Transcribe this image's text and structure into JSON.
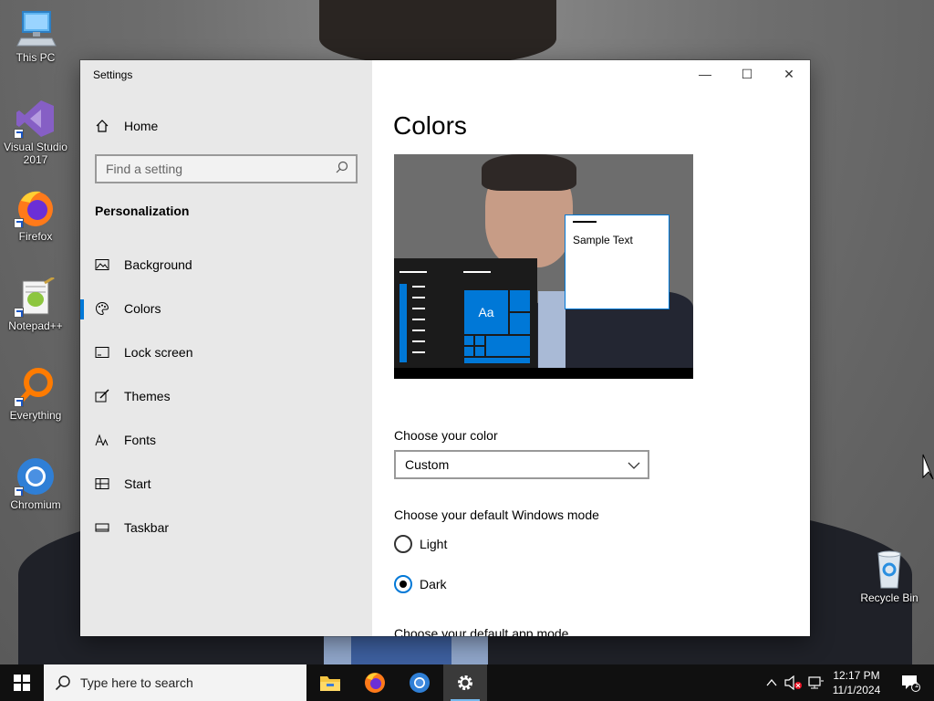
{
  "desktop": {
    "icons": [
      {
        "label": "This PC",
        "icon": "computer-icon"
      },
      {
        "label": "Visual Studio 2017",
        "icon": "visual-studio-icon"
      },
      {
        "label": "Firefox",
        "icon": "firefox-icon"
      },
      {
        "label": "Notepad++",
        "icon": "notepad-plus-plus-icon"
      },
      {
        "label": "Everything",
        "icon": "everything-search-icon"
      },
      {
        "label": "Chromium",
        "icon": "chromium-icon"
      },
      {
        "label": "Recycle Bin",
        "icon": "recycle-bin-icon"
      }
    ]
  },
  "window": {
    "title": "Settings",
    "controls": {
      "minimize": "—",
      "maximize": "☐",
      "close": "✕"
    }
  },
  "sidebar": {
    "home_label": "Home",
    "search_placeholder": "Find a setting",
    "section_title": "Personalization",
    "items": [
      {
        "label": "Background",
        "icon": "image-icon"
      },
      {
        "label": "Colors",
        "icon": "palette-icon",
        "active": true
      },
      {
        "label": "Lock screen",
        "icon": "lock-screen-icon"
      },
      {
        "label": "Themes",
        "icon": "themes-brush-icon"
      },
      {
        "label": "Fonts",
        "icon": "font-icon"
      },
      {
        "label": "Start",
        "icon": "start-grid-icon"
      },
      {
        "label": "Taskbar",
        "icon": "taskbar-icon"
      }
    ]
  },
  "main": {
    "title": "Colors",
    "preview": {
      "sample_text": "Sample Text",
      "tile_label": "Aa"
    },
    "choose_color_label": "Choose your color",
    "color_select_value": "Custom",
    "windows_mode_label": "Choose your default Windows mode",
    "windows_mode_options": [
      {
        "label": "Light",
        "checked": false
      },
      {
        "label": "Dark",
        "checked": true
      }
    ],
    "app_mode_label": "Choose your default app mode"
  },
  "taskbar": {
    "search_placeholder": "Type here to search",
    "apps": [
      "file-explorer-icon",
      "firefox-icon",
      "chromium-icon",
      "settings-gear-icon"
    ],
    "clock_time": "12:17 PM",
    "clock_date": "11/1/2024",
    "notification_count": "1"
  },
  "colors": {
    "accent": "#0078d7",
    "sidebar_bg": "#e8e8e8",
    "taskbar_bg": "#101010"
  }
}
